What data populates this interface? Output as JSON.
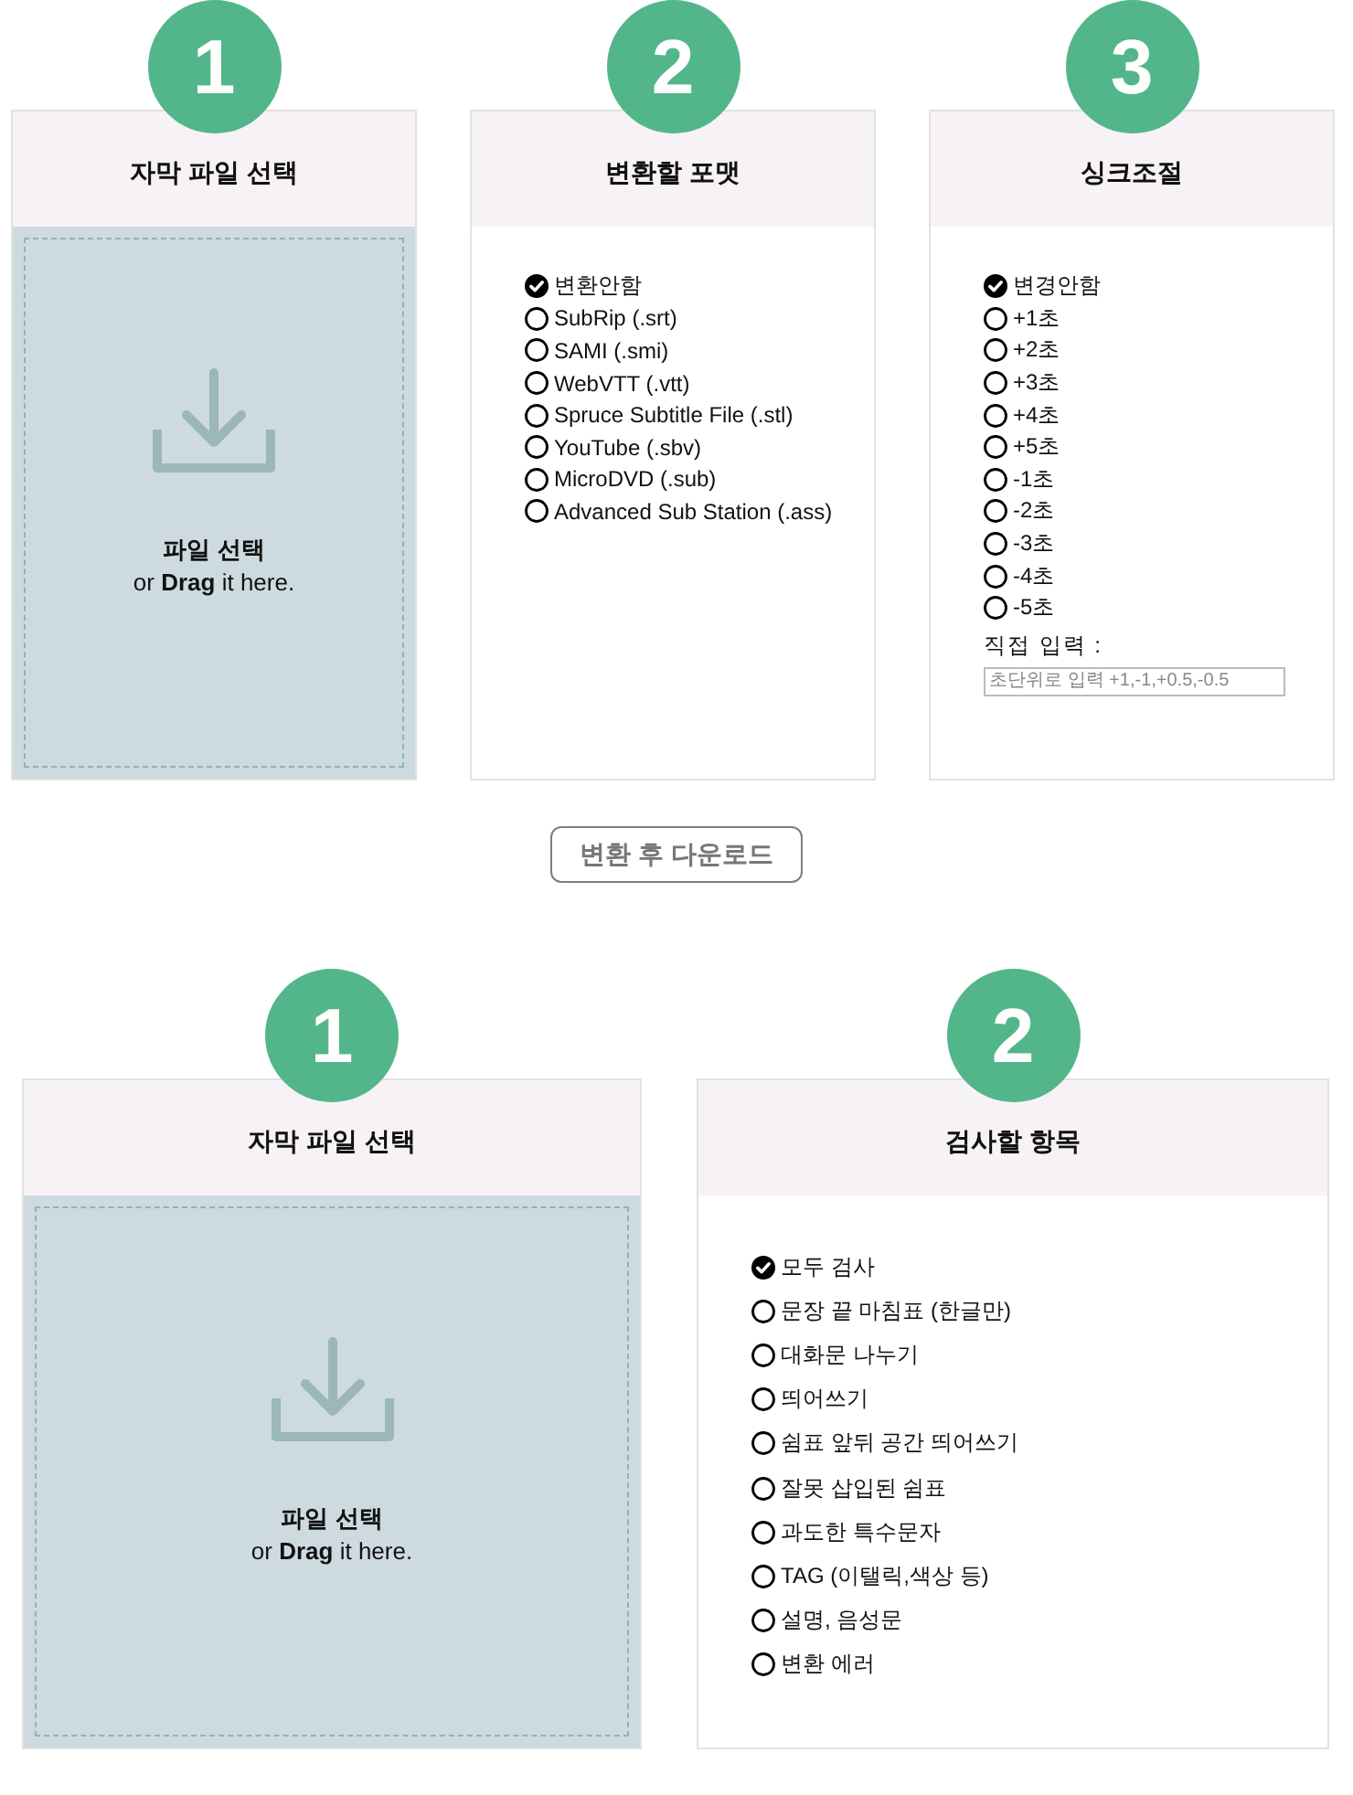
{
  "converter": {
    "steps": [
      {
        "kind": "upload",
        "number": "1",
        "title": "자막 파일 선택",
        "drop_label": "파일 선택",
        "drop_hint": "or **Drag** it here."
      },
      {
        "kind": "options",
        "number": "2",
        "title": "변환할 포맷",
        "options": [
          {
            "label": "변환안함",
            "selected": true
          },
          {
            "label": "SubRip (.srt)",
            "selected": false
          },
          {
            "label": "SAMI (.smi)",
            "selected": false
          },
          {
            "label": "WebVTT (.vtt)",
            "selected": false
          },
          {
            "label": "Spruce Subtitle File (.stl)",
            "selected": false
          },
          {
            "label": "YouTube (.sbv)",
            "selected": false
          },
          {
            "label": "MicroDVD (.sub)",
            "selected": false
          },
          {
            "label": "Advanced Sub Station (.ass)",
            "selected": false
          }
        ]
      },
      {
        "kind": "options",
        "number": "3",
        "title": "싱크조절",
        "options": [
          {
            "label": "변경안함",
            "selected": true
          },
          {
            "label": "+1초",
            "selected": false
          },
          {
            "label": "+2초",
            "selected": false
          },
          {
            "label": "+3초",
            "selected": false
          },
          {
            "label": "+4초",
            "selected": false
          },
          {
            "label": "+5초",
            "selected": false
          },
          {
            "label": "-1초",
            "selected": false
          },
          {
            "label": "-2초",
            "selected": false
          },
          {
            "label": "-3초",
            "selected": false
          },
          {
            "label": "-4초",
            "selected": false
          },
          {
            "label": "-5초",
            "selected": false
          }
        ],
        "custom_input": {
          "label": "직접 입력 :",
          "placeholder": "초단위로 입력 +1,-1,+0.5,-0.5"
        }
      }
    ],
    "action_button": "변환 후 다운로드"
  },
  "checker": {
    "steps": [
      {
        "kind": "upload",
        "number": "1",
        "title": "자막 파일 선택",
        "drop_label": "파일 선택",
        "drop_hint": "or **Drag** it here."
      },
      {
        "kind": "options",
        "number": "2",
        "title": "검사할 항목",
        "options": [
          {
            "label": "모두 검사",
            "selected": true
          },
          {
            "label": "문장 끝 마침표 (한글만)",
            "selected": false
          },
          {
            "label": "대화문 나누기",
            "selected": false
          },
          {
            "label": "띄어쓰기",
            "selected": false
          },
          {
            "label": "쉼표 앞뒤 공간 띄어쓰기",
            "selected": false
          },
          {
            "label": "잘못 삽입된 쉼표",
            "selected": false
          },
          {
            "label": "과도한 특수문자",
            "selected": false
          },
          {
            "label": "TAG (이탤릭,색상 등)",
            "selected": false
          },
          {
            "label": "설명, 음성문",
            "selected": false
          },
          {
            "label": "변환 에러",
            "selected": false
          }
        ]
      }
    ]
  }
}
